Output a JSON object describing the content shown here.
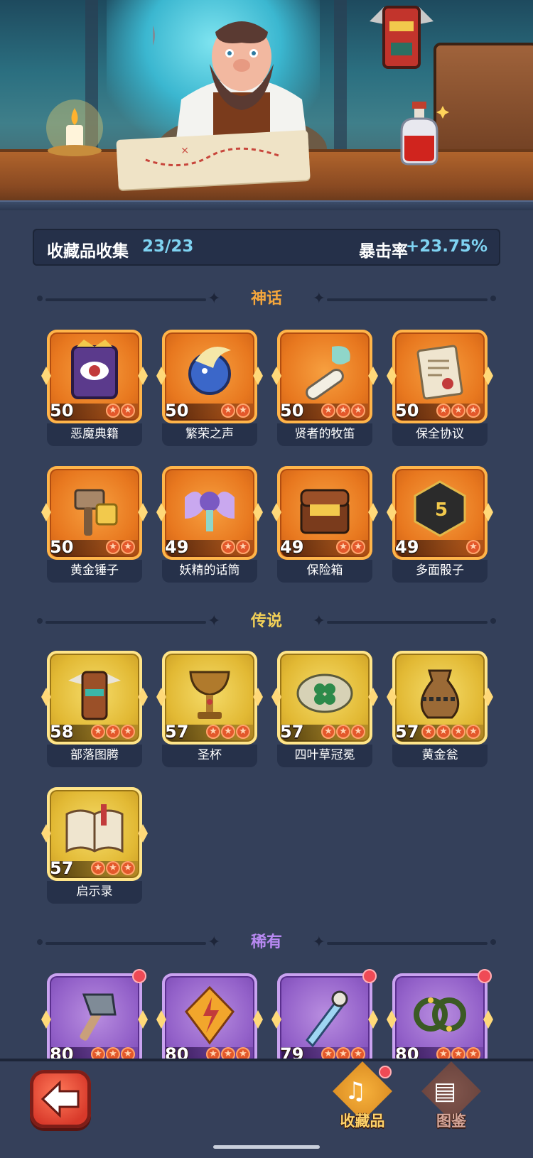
{
  "summary": {
    "label": "收藏品收集",
    "count": "23/23",
    "crit_label": "暴击率",
    "crit_value": "+23.75%"
  },
  "sections": {
    "mythic": "神话",
    "legendary": "传说",
    "rare": "稀有"
  },
  "colors": {
    "mythic_title": "#f6a73c",
    "legendary_title": "#f3d157",
    "rare_title": "#b889f2",
    "accent": "#7fd3f2"
  },
  "mythic": [
    {
      "name": "恶魔典籍",
      "level": "50",
      "stars": 2,
      "icon": "demon-book-icon"
    },
    {
      "name": "繁荣之声",
      "level": "50",
      "stars": 2,
      "icon": "prosperity-orb-icon"
    },
    {
      "name": "贤者的牧笛",
      "level": "50",
      "stars": 3,
      "icon": "sage-flute-icon"
    },
    {
      "name": "保全协议",
      "level": "50",
      "stars": 3,
      "icon": "protocol-scroll-icon"
    },
    {
      "name": "黄金锤子",
      "level": "50",
      "stars": 2,
      "icon": "golden-hammer-icon"
    },
    {
      "name": "妖精的话筒",
      "level": "49",
      "stars": 2,
      "icon": "fairy-microphone-icon"
    },
    {
      "name": "保险箱",
      "level": "49",
      "stars": 2,
      "icon": "treasure-chest-icon"
    },
    {
      "name": "多面骰子",
      "level": "49",
      "stars": 1,
      "icon": "d20-dice-icon"
    }
  ],
  "legendary": [
    {
      "name": "部落图腾",
      "level": "58",
      "stars": 3,
      "icon": "tribal-totem-icon"
    },
    {
      "name": "圣杯",
      "level": "57",
      "stars": 3,
      "icon": "holy-grail-icon"
    },
    {
      "name": "四叶草冠冕",
      "level": "57",
      "stars": 3,
      "icon": "clover-crown-icon"
    },
    {
      "name": "黄金瓮",
      "level": "57",
      "stars": 4,
      "icon": "golden-urn-icon"
    },
    {
      "name": "启示录",
      "level": "57",
      "stars": 3,
      "icon": "revelation-book-icon"
    }
  ],
  "rare": [
    {
      "level": "80",
      "icon": "stone-axe-icon"
    },
    {
      "level": "80",
      "icon": "lightning-crystal-icon"
    },
    {
      "level": "79",
      "icon": "ice-sword-icon"
    },
    {
      "level": "80",
      "icon": "thorn-ring-icon"
    }
  ],
  "nav": {
    "collection_label": "收藏品",
    "codex_label": "图鉴"
  }
}
